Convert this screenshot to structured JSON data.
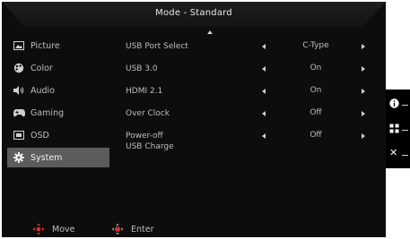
{
  "header": {
    "title": "Mode - Standard"
  },
  "sidebar": {
    "items": [
      {
        "label": "Picture",
        "icon": "picture-icon",
        "active": false
      },
      {
        "label": "Color",
        "icon": "color-palette-icon",
        "active": false
      },
      {
        "label": "Audio",
        "icon": "speaker-icon",
        "active": false
      },
      {
        "label": "Gaming",
        "icon": "gamepad-icon",
        "active": false
      },
      {
        "label": "OSD",
        "icon": "osd-icon",
        "active": false
      },
      {
        "label": "System",
        "icon": "gear-icon",
        "active": true
      }
    ]
  },
  "settings": [
    {
      "label": "USB Port Select",
      "value": "C-Type"
    },
    {
      "label": "USB 3.0",
      "value": "On"
    },
    {
      "label": "HDMI 2.1",
      "value": "On"
    },
    {
      "label": "Over Clock",
      "value": "Off"
    },
    {
      "label": "Power-off",
      "label2": "USB Charge",
      "value": "Off"
    }
  ],
  "footer": {
    "move_label": "Move",
    "enter_label": "Enter"
  },
  "side_keys": [
    {
      "icon": "info-icon",
      "glyph": "i"
    },
    {
      "icon": "grid-icon",
      "glyph": ""
    },
    {
      "icon": "close-icon",
      "glyph": "✕"
    }
  ],
  "colors": {
    "active_bg": "#5c5c5c",
    "panel_bg": "#0d0d0d",
    "accent_red": "#d0312d"
  }
}
